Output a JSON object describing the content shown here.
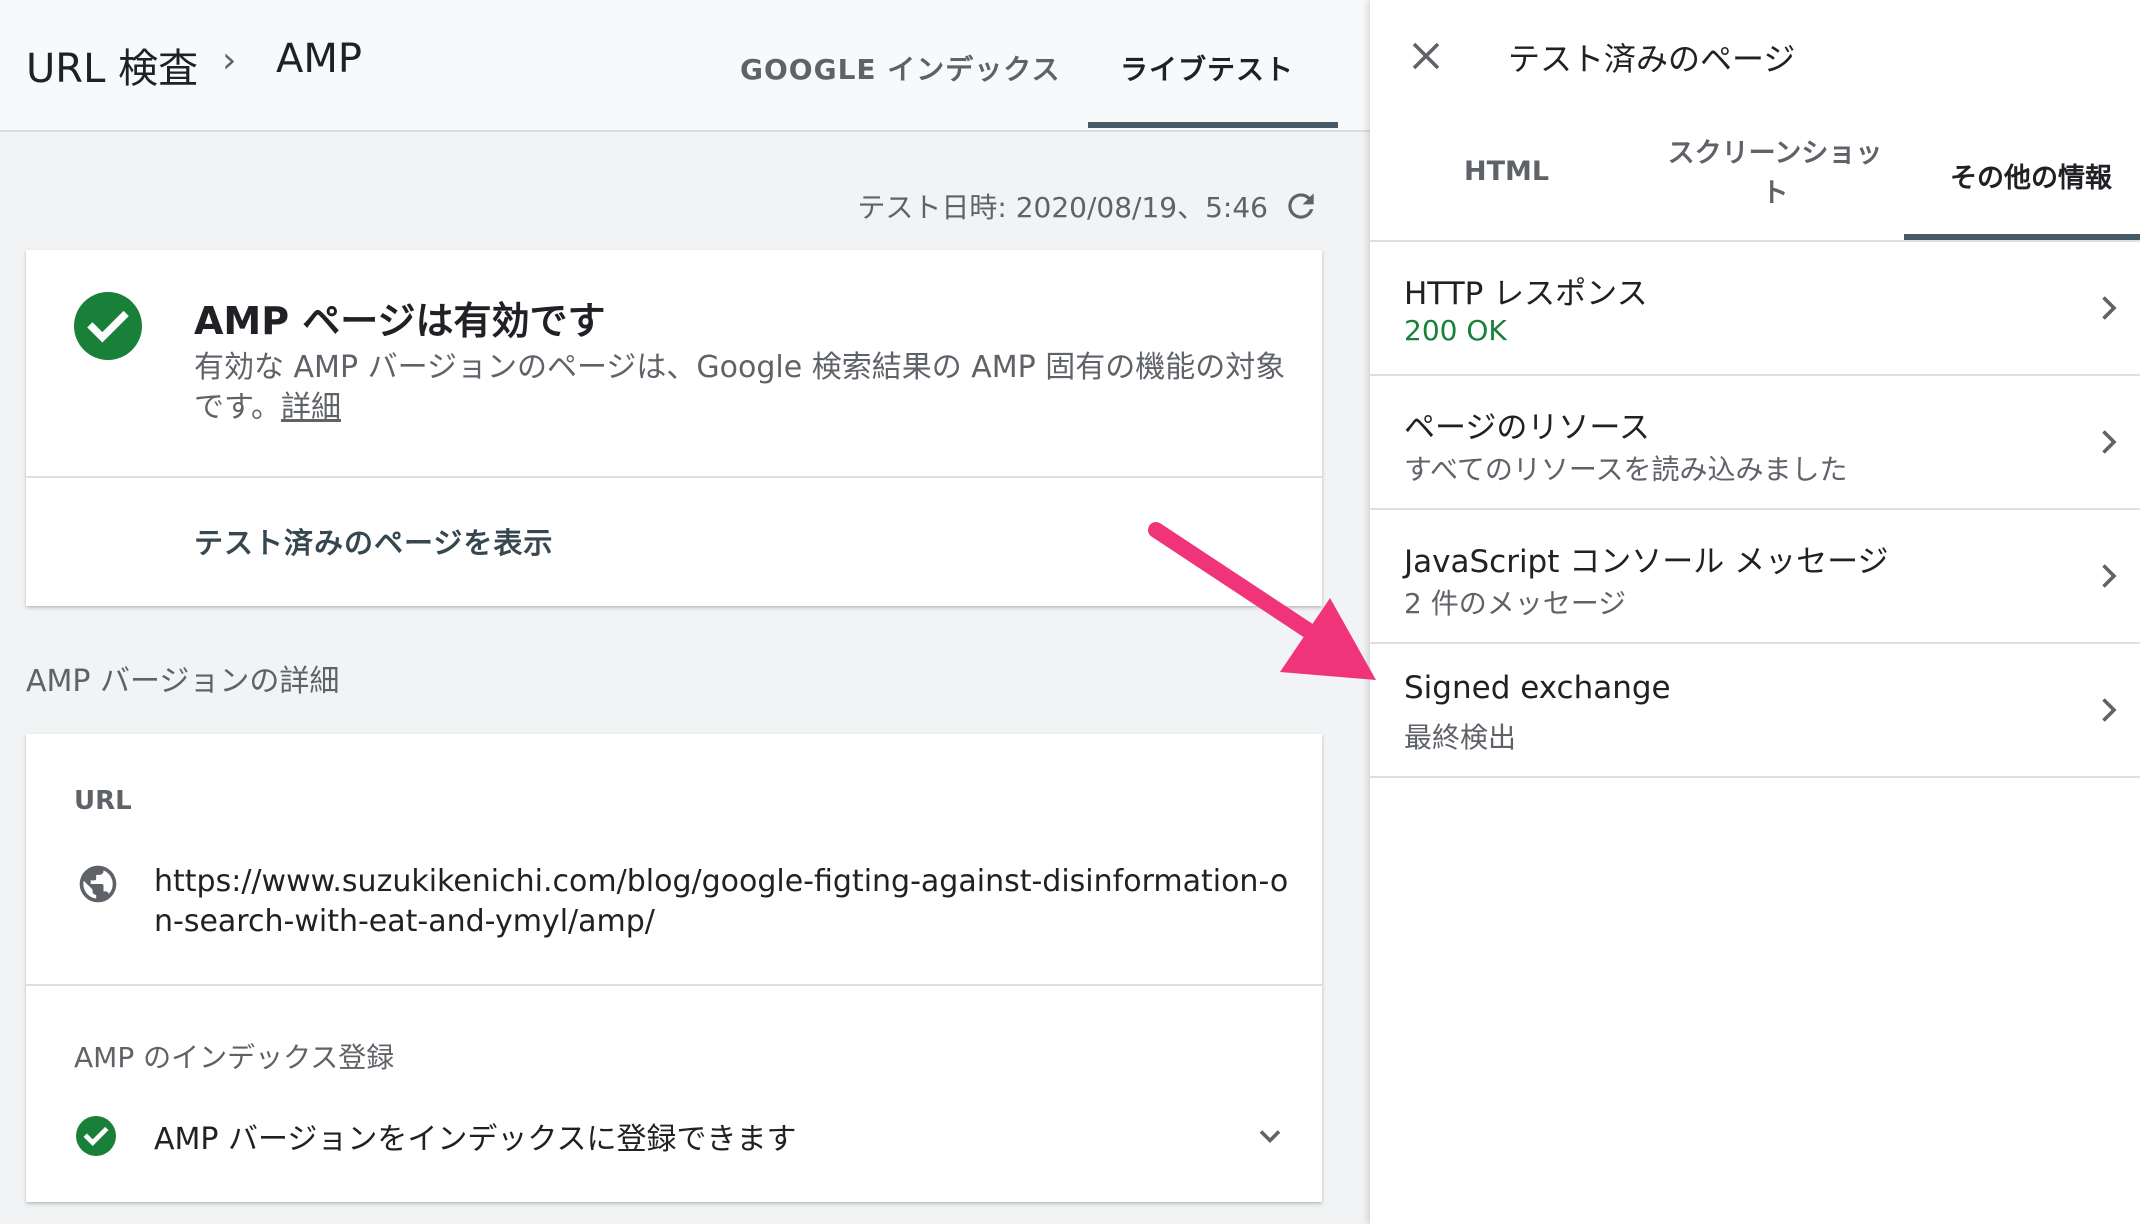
{
  "header": {
    "breadcrumb_root": "URL 検査",
    "breadcrumb_current": "AMP",
    "tabs": [
      {
        "label": "GOOGLE インデックス",
        "active": false
      },
      {
        "label": "ライブテスト",
        "active": true
      }
    ]
  },
  "test_date": "テスト日時: 2020/08/19、5:46",
  "status_card": {
    "title": "AMP ページは有効です",
    "description": "有効な AMP バージョンのページは、Google 検索結果の AMP 固有の機能の対象です。",
    "link": "詳細",
    "view_tested_button": "テスト済みのページを表示"
  },
  "section_heading": "AMP バージョンの詳細",
  "details": {
    "url_label": "URL",
    "url_value": "https://www.suzukikenichi.com/blog/google-figting-against-disinformation-on-search-with-eat-and-ymyl/amp/",
    "index_label": "AMP のインデックス登録",
    "index_status": "AMP バージョンをインデックスに登録できます"
  },
  "panel": {
    "title": "テスト済みのページ",
    "tabs": [
      {
        "label": "HTML",
        "active": false
      },
      {
        "label": "スクリーンショット",
        "active": false
      },
      {
        "label": "その他の情報",
        "active": true
      }
    ],
    "rows": [
      {
        "title": "HTTP レスポンス",
        "subtitle": "200 OK"
      },
      {
        "title": "ページのリソース",
        "subtitle": "すべてのリソースを読み込みました"
      },
      {
        "title": "JavaScript コンソール メッセージ",
        "subtitle": "2 件のメッセージ"
      },
      {
        "title": "Signed exchange",
        "subtitle": "最終検出"
      }
    ]
  },
  "colors": {
    "success_green": "#188038",
    "tab_indicator": "#455a64",
    "annotation_arrow": "#f0347a"
  },
  "icons": [
    "refresh-icon",
    "check-circle-icon",
    "globe-icon",
    "chevron-down-icon",
    "close-icon",
    "chevron-right-icon"
  ]
}
